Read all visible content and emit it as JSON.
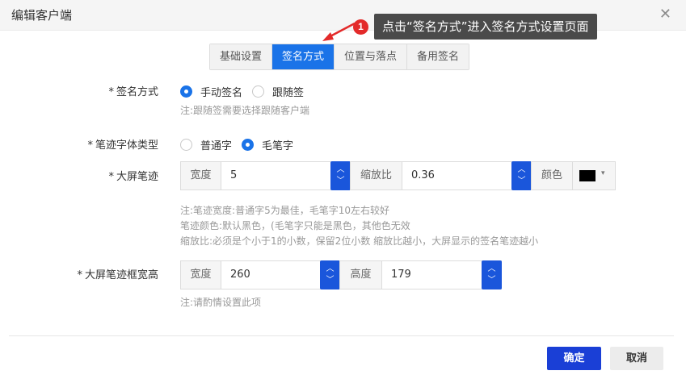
{
  "dialog": {
    "title": "编辑客户端",
    "close_glyph": "✕"
  },
  "callout": {
    "badge": "1",
    "text": "点击“签名方式”进入签名方式设置页面"
  },
  "tabs": [
    {
      "label": "基础设置"
    },
    {
      "label": "签名方式"
    },
    {
      "label": "位置与落点"
    },
    {
      "label": "备用签名"
    }
  ],
  "active_tab": "签名方式",
  "required_mark": "*",
  "sign_mode": {
    "label": "签名方式",
    "options": [
      "手动签名",
      "跟随签"
    ],
    "selected": "手动签名",
    "note": "注:跟随签需要选择跟随客户端"
  },
  "stroke_font": {
    "label": "笔迹字体类型",
    "options": [
      "普通字",
      "毛笔字"
    ],
    "selected": "毛笔字"
  },
  "big_screen_stroke": {
    "label": "大屏笔迹",
    "width_label": "宽度",
    "width_value": "5",
    "scale_label": "缩放比",
    "scale_value": "0.36",
    "color_label": "颜色",
    "color_value": "#000000",
    "notes": [
      "注:笔迹宽度:普通字5为最佳，毛笔字10左右较好",
      "笔迹颜色:默认黑色，(毛笔字只能是黑色，其他色无效",
      "缩放比:必须是个小于1的小数，保留2位小数 缩放比越小，大屏显示的签名笔迹越小"
    ]
  },
  "big_screen_box": {
    "label": "大屏笔迹框宽高",
    "width_label": "宽度",
    "width_value": "260",
    "height_label": "高度",
    "height_value": "179",
    "note": "注:请酌情设置此项"
  },
  "spin_glyphs": {
    "up": "︿",
    "down": "﹀"
  },
  "footer": {
    "confirm": "确定",
    "cancel": "取消"
  },
  "colors": {
    "accent": "#1a73e8",
    "primary_button": "#1a3fd6",
    "callout_badge": "#e32a2a"
  }
}
